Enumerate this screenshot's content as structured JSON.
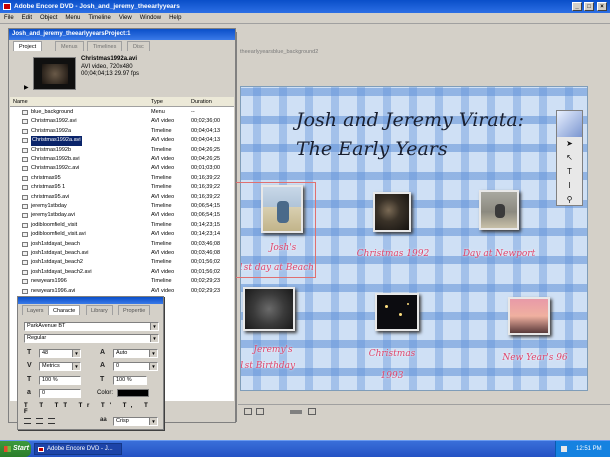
{
  "window": {
    "title": "Adobe Encore DVD - Josh_and_jeremy_theearlyyears",
    "min": "_",
    "max": "□",
    "close": "×"
  },
  "menu": [
    "File",
    "Edit",
    "Object",
    "Menu",
    "Timeline",
    "View",
    "Window",
    "Help"
  ],
  "monitor": {
    "tab_label": "theearlyyearsblue_background2",
    "title_line1": "Josh and Jeremy Virata:",
    "title_line2": "The Early Years",
    "buttons": [
      {
        "line1": "Josh's",
        "line2": "1st day at Beach"
      },
      {
        "line1": "Christmas 1992",
        "line2": ""
      },
      {
        "line1": "Day at Newport",
        "line2": ""
      },
      {
        "line1": "Jeremy's",
        "line2": "1st Birthday"
      },
      {
        "line1": "Christmas",
        "line2": "1993"
      },
      {
        "line1": "New Year's 96",
        "line2": ""
      }
    ],
    "tools": [
      "selection-tool",
      "direct-select-tool",
      "text-tool",
      "vertical-text-tool",
      "zoom-tool"
    ]
  },
  "project": {
    "title": "Josh_and_jeremy_theearlyyearsProject:1",
    "tabs": [
      "Project",
      "Menus",
      "Timelines",
      "Disc"
    ],
    "selected_file": "Christmas1992a.avi",
    "selected_info1": "AVI video, 720x480",
    "selected_info2": "00;04;04;13 29.97 fps",
    "columns": {
      "name": "Name",
      "type": "Type",
      "duration": "Duration"
    },
    "files": [
      {
        "name": "blue_background",
        "type": "Menu",
        "duration": "--"
      },
      {
        "name": "Christmas1992.avi",
        "type": "AVI video",
        "duration": "00;02;36;00"
      },
      {
        "name": "Christmas1992a",
        "type": "Timeline",
        "duration": "00;04;04;13"
      },
      {
        "name": "Christmas1992a.avi",
        "type": "AVI video",
        "duration": "00;04;04;13"
      },
      {
        "name": "Christmas1992b",
        "type": "Timeline",
        "duration": "00;04;26;25"
      },
      {
        "name": "Christmas1992b.avi",
        "type": "AVI video",
        "duration": "00;04;26;25"
      },
      {
        "name": "Christmas1992c.avi",
        "type": "AVI video",
        "duration": "00;01;03;00"
      },
      {
        "name": "christmas95",
        "type": "Timeline",
        "duration": "00;16;39;22"
      },
      {
        "name": "christmas95 1",
        "type": "Timeline",
        "duration": "00;16;39;22"
      },
      {
        "name": "christmas95.avi",
        "type": "AVI video",
        "duration": "00;16;39;22"
      },
      {
        "name": "jeremy1stbday",
        "type": "Timeline",
        "duration": "00;06;54;15"
      },
      {
        "name": "jeremy1stbday.avi",
        "type": "AVI video",
        "duration": "00;06;54;15"
      },
      {
        "name": "jodibloomfield_visit",
        "type": "Timeline",
        "duration": "00;14;23;15"
      },
      {
        "name": "jodibloomfield_visit.avi",
        "type": "AVI video",
        "duration": "00;14;23;14"
      },
      {
        "name": "josh1stdayat_beach",
        "type": "Timeline",
        "duration": "00;03;46;08"
      },
      {
        "name": "josh1stdayat_beach.avi",
        "type": "AVI video",
        "duration": "00;03;46;08"
      },
      {
        "name": "josh1stdayat_beach2",
        "type": "Timeline",
        "duration": "00;01;56;02"
      },
      {
        "name": "josh1stdayat_beach2.avi",
        "type": "AVI video",
        "duration": "00;01;56;02"
      },
      {
        "name": "newyears1996",
        "type": "Timeline",
        "duration": "00;02;29;23"
      },
      {
        "name": "newyears1996.avi",
        "type": "AVI video",
        "duration": "00;02;29;23"
      }
    ]
  },
  "character": {
    "tabs": [
      "Layers",
      "Characte",
      "Library",
      "Propertie"
    ],
    "font": "ParkAvenue BT",
    "style": "Regular",
    "size": "48",
    "leading": "Auto",
    "kerning": "Metrics",
    "tracking": "0",
    "vscale": "100 %",
    "hscale": "100 %",
    "baseline": "0",
    "color_label": "Color:",
    "antialias": "Crisp"
  },
  "taskbar": {
    "start": "Start",
    "item": "Adobe Encore DVD - J...",
    "clock": "12:51 PM"
  }
}
